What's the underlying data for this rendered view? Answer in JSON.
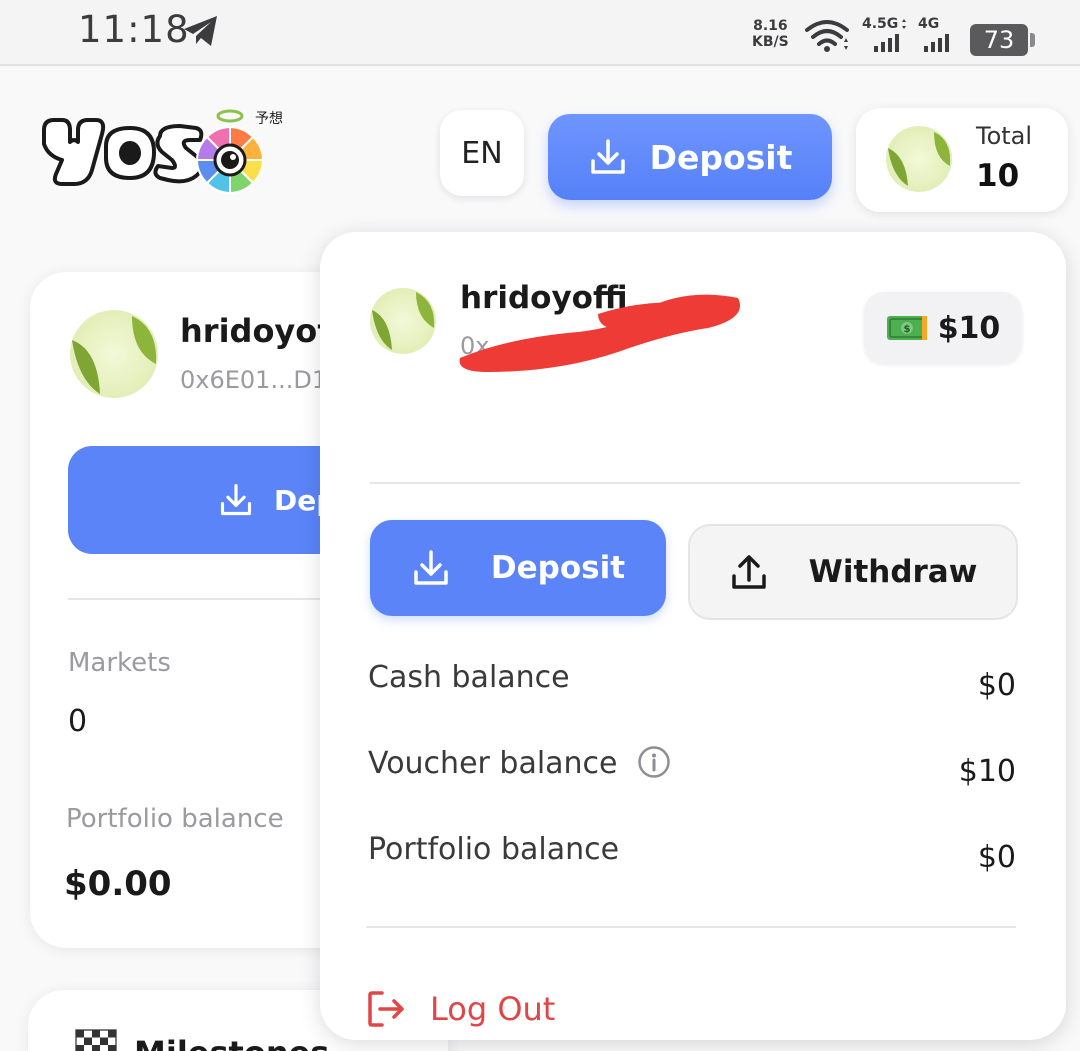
{
  "status_bar": {
    "time": "11:18",
    "net_speed_value": "8.16",
    "net_speed_unit": "KB/S",
    "signal1_label": "4.5G",
    "signal2_label": "4G",
    "battery": "73",
    "icons": [
      "telegram-icon",
      "wifi-icon",
      "signal-icon",
      "signal-icon",
      "battery-icon"
    ]
  },
  "header": {
    "logo_text": "yoso",
    "logo_subtext": "予想",
    "language_label": "EN",
    "deposit_label": "Deposit",
    "total_label": "Total",
    "total_value": "10"
  },
  "profile_card": {
    "username": "hridoyof",
    "address": "0x6E01...D1",
    "deposit_label": "Dep",
    "markets_label": "Markets",
    "markets_value": "0",
    "portfolio_label": "Portfolio balance",
    "portfolio_value": "$0.00"
  },
  "milestones": {
    "label": "Milestones"
  },
  "dropdown": {
    "username": "hridoyoffi",
    "address": "0x",
    "balance_pill": "$10",
    "deposit_label": "Deposit",
    "withdraw_label": "Withdraw",
    "rows": [
      {
        "label": "Cash balance",
        "value": "$0"
      },
      {
        "label": "Voucher balance",
        "value": "$10"
      },
      {
        "label": "Portfolio balance",
        "value": "$0"
      }
    ],
    "logout_label": "Log Out"
  },
  "colors": {
    "accent_blue": "#5a84f8",
    "logout_red": "#e14545",
    "redaction_red": "#ef3b36"
  }
}
